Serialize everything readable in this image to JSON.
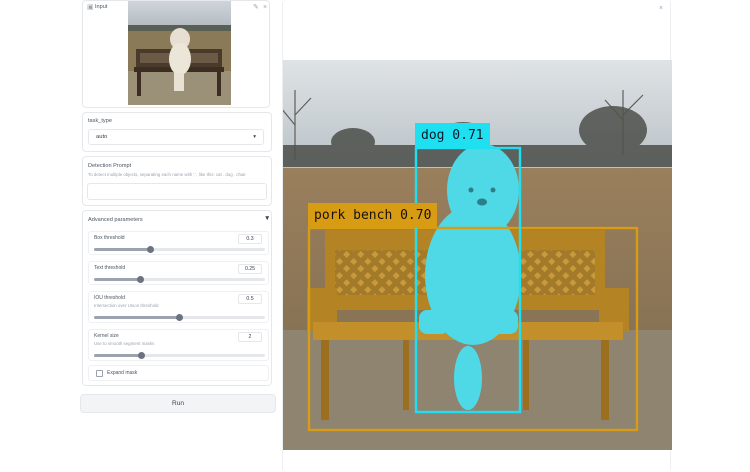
{
  "input_image": {
    "label": "Input"
  },
  "task_type": {
    "label": "task_type",
    "value": "auto"
  },
  "detection_prompt": {
    "label": "Detection Prompt",
    "hint": "To detect multiple objects, separating each name with '.', like this: cat . dog . chair",
    "value": ""
  },
  "advanced": {
    "title": "Advanced parameters",
    "box_threshold": {
      "label": "Box threshold",
      "value": "0.3",
      "fraction": 0.33
    },
    "text_threshold": {
      "label": "Text threshold",
      "value": "0.25",
      "fraction": 0.27
    },
    "iou_threshold": {
      "label": "IOU threshold",
      "hint": "Intersection over Union threshold",
      "value": "0.5",
      "fraction": 0.5
    },
    "kernel_size": {
      "label": "Kernel size",
      "hint": "Use to smooth segment masks",
      "value": "2",
      "fraction": 0.28
    },
    "expand_mask": {
      "label": "Expand mask",
      "checked": false
    }
  },
  "run_button": {
    "label": "Run"
  },
  "output": {
    "detections": [
      {
        "label": "dog 0.71",
        "color": "#1fe0f0"
      },
      {
        "label": "pork bench 0.70",
        "color": "#d79c13"
      }
    ]
  },
  "colors": {
    "dog_mask": "#4fd8e6",
    "bench_box": "#d79c13",
    "dog_box": "#1fe0f0"
  }
}
